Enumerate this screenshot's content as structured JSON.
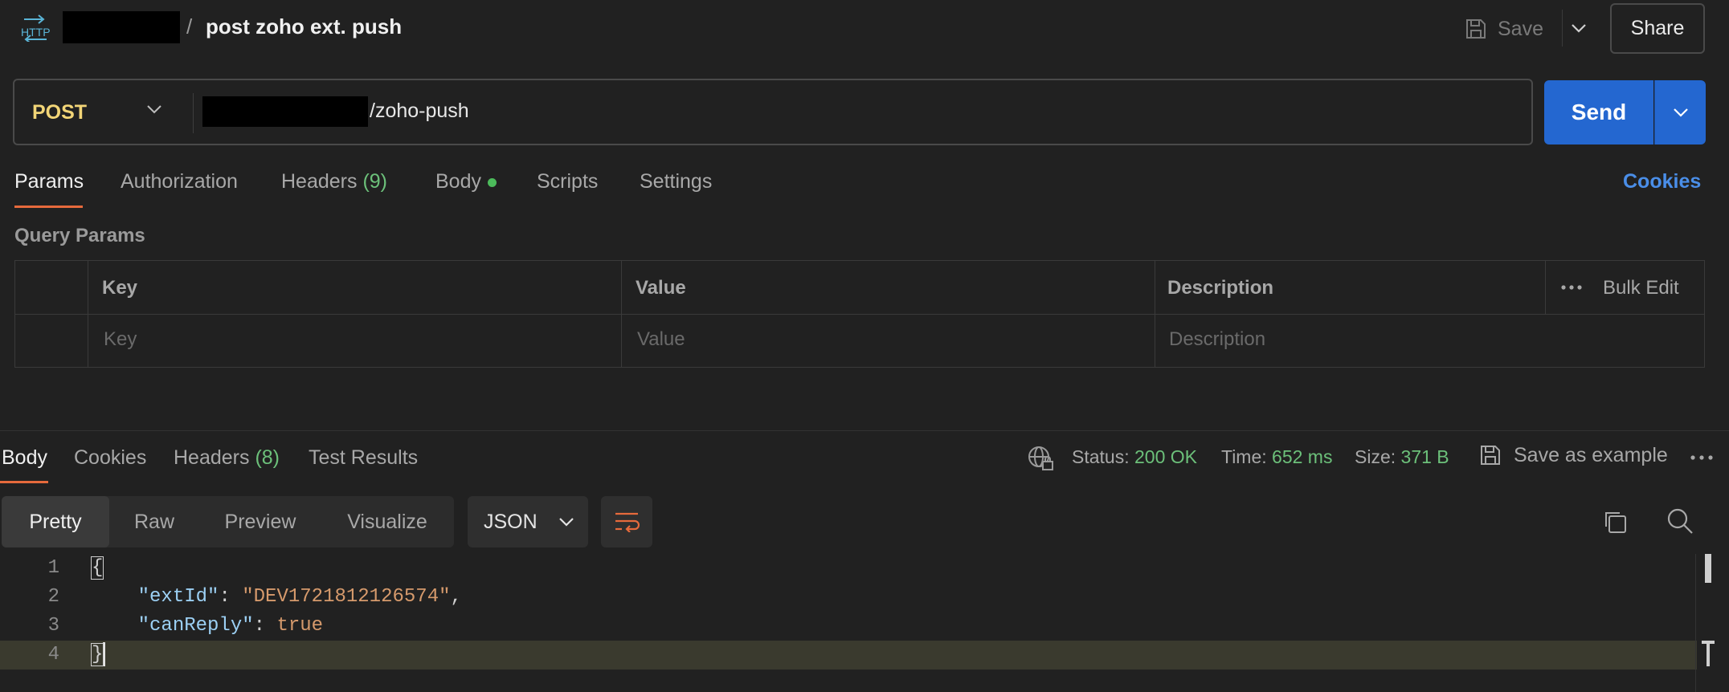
{
  "header": {
    "separator": "/",
    "request_name": "post zoho ext. push",
    "save_label": "Save",
    "share_label": "Share"
  },
  "request": {
    "method": "POST",
    "url_suffix": "/zoho-push",
    "send_label": "Send"
  },
  "request_tabs": {
    "params": "Params",
    "authorization": "Authorization",
    "headers": "Headers",
    "headers_count": "(9)",
    "body": "Body",
    "scripts": "Scripts",
    "settings": "Settings",
    "cookies": "Cookies"
  },
  "query_params": {
    "title": "Query Params",
    "headers": {
      "key": "Key",
      "value": "Value",
      "description": "Description"
    },
    "bulk_edit": "Bulk Edit",
    "placeholders": {
      "key": "Key",
      "value": "Value",
      "description": "Description"
    }
  },
  "response_tabs": {
    "body": "Body",
    "cookies": "Cookies",
    "headers": "Headers",
    "headers_count": "(8)",
    "test_results": "Test Results"
  },
  "response_meta": {
    "status_label": "Status:",
    "status_value": "200 OK",
    "time_label": "Time:",
    "time_value": "652 ms",
    "size_label": "Size:",
    "size_value": "371 B",
    "save_example": "Save as example"
  },
  "format_toolbar": {
    "pretty": "Pretty",
    "raw": "Raw",
    "preview": "Preview",
    "visualize": "Visualize",
    "language": "JSON"
  },
  "code": {
    "line_numbers": [
      "1",
      "2",
      "3",
      "4"
    ],
    "open_brace": "{",
    "close_brace": "}",
    "key1": "\"extId\"",
    "value1": "\"DEV1721812126574\"",
    "key2": "\"canReply\"",
    "value2": "true"
  },
  "colors": {
    "accent_orange": "#e66a3c",
    "send_blue": "#2467d0",
    "method_yellow": "#f2d577",
    "success_green": "#6cc07a",
    "link_blue": "#4a8ee8"
  }
}
